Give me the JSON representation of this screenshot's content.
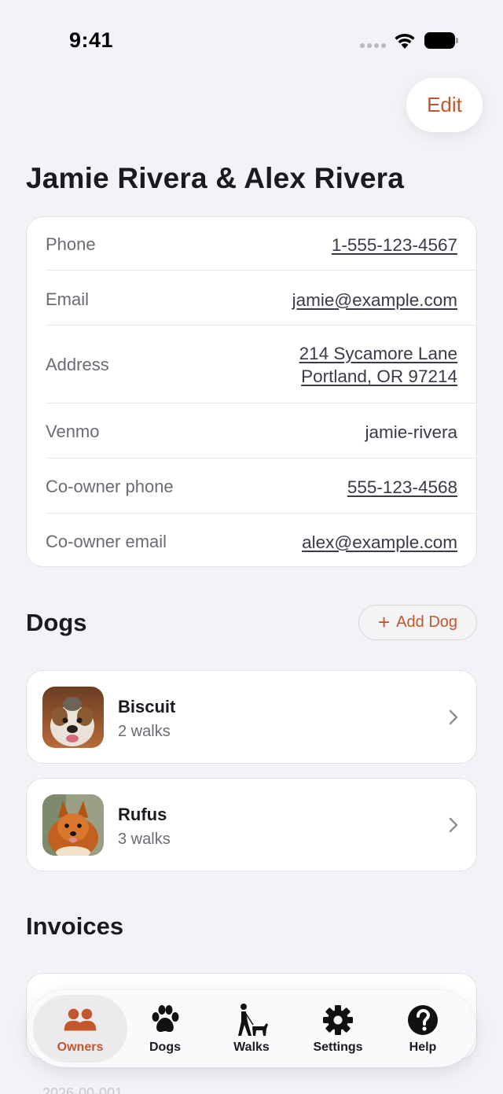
{
  "status_bar": {
    "time": "9:41"
  },
  "header": {
    "edit_label": "Edit",
    "title": "Jamie Rivera & Alex Rivera"
  },
  "contact": {
    "rows": [
      {
        "label": "Phone",
        "value": "1-555-123-4567"
      },
      {
        "label": "Email",
        "value": "jamie@example.com"
      },
      {
        "label": "Address",
        "value_line1": "214 Sycamore Lane",
        "value_line2": "Portland, OR 97214"
      },
      {
        "label": "Venmo",
        "value": "jamie-rivera"
      },
      {
        "label": "Co-owner phone",
        "value": "555-123-4568"
      },
      {
        "label": "Co-owner email",
        "value": "alex@example.com"
      }
    ]
  },
  "dogs": {
    "section_title": "Dogs",
    "add_label": "Add Dog",
    "items": [
      {
        "name": "Biscuit",
        "walks": "2 walks"
      },
      {
        "name": "Rufus",
        "walks": "3 walks"
      }
    ]
  },
  "invoices": {
    "section_title": "Invoices",
    "partial_text": "2026-00-001"
  },
  "tab_bar": {
    "tabs": [
      {
        "label": "Owners",
        "icon": "people-icon",
        "active": true
      },
      {
        "label": "Dogs",
        "icon": "paw-icon",
        "active": false
      },
      {
        "label": "Walks",
        "icon": "dog-walker-icon",
        "active": false
      },
      {
        "label": "Settings",
        "icon": "gear-icon",
        "active": false
      },
      {
        "label": "Help",
        "icon": "question-circle-icon",
        "active": false
      }
    ]
  },
  "colors": {
    "accent": "#c2562c",
    "background": "#f2f2f7",
    "card": "#ffffff",
    "text": "#1a1a20",
    "secondary_text": "#6b6b74"
  }
}
